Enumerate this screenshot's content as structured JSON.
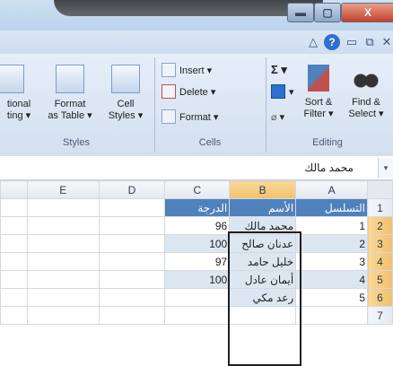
{
  "window": {
    "min_icon": "minimize-icon",
    "max_icon": "maximize-icon",
    "close_icon": "close-icon",
    "close_label": "X"
  },
  "helpbar": {
    "icons": [
      "up-arrow-icon",
      "help-icon",
      "minimize-ribbon-icon",
      "restore-icon",
      "close-icon"
    ],
    "help_label": "?"
  },
  "ribbon": {
    "styles_group": {
      "label": "Styles",
      "conditional_label_line1": "tional",
      "conditional_label_line2": "ting ▾",
      "format_table_line1": "Format",
      "format_table_line2": "as Table ▾",
      "cell_styles_line1": "Cell",
      "cell_styles_line2": "Styles ▾"
    },
    "cells_group": {
      "label": "Cells",
      "insert": "Insert ▾",
      "delete": "Delete ▾",
      "format": "Format ▾"
    },
    "editing_group": {
      "label": "Editing",
      "sum_symbol": "Σ ▾",
      "fill_arrow": "▾",
      "clear_arrow": "▾",
      "sort_line1": "Sort &",
      "sort_line2": "Filter ▾",
      "find_line1": "Find &",
      "find_line2": "Select ▾"
    }
  },
  "formula_bar": {
    "value": "محمد مالك",
    "expand": "▾"
  },
  "sheet": {
    "columns": [
      "E",
      "D",
      "C",
      "B",
      "A"
    ],
    "rows": [
      "1",
      "2",
      "3",
      "4",
      "5",
      "6",
      "7"
    ],
    "header": {
      "c": "الدرجة",
      "b": "الأسم",
      "a": "التسلسل"
    },
    "data": [
      {
        "c": "96",
        "b": "محمد مالك",
        "a": "1"
      },
      {
        "c": "100",
        "b": "عدنان صالح",
        "a": "2"
      },
      {
        "c": "97",
        "b": "خليل حامد",
        "a": "3"
      },
      {
        "c": "100",
        "b": "أيمان عادل",
        "a": "4"
      },
      {
        "c": "",
        "b": "رعد مكي",
        "a": "5"
      }
    ]
  },
  "colors": {
    "header_fill": "#4f81bd",
    "band_fill": "#dce6f1",
    "selected_header": "#f2c06a"
  }
}
